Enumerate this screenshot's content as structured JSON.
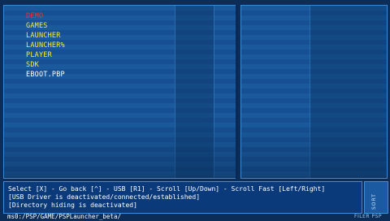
{
  "file_list": {
    "items": [
      {
        "name": "DEMO",
        "type": "folder",
        "selected": true
      },
      {
        "name": "GAMES",
        "type": "folder",
        "selected": false
      },
      {
        "name": "LAUNCHER",
        "type": "folder",
        "selected": false
      },
      {
        "name": "LAUNCHER%",
        "type": "folder",
        "selected": false
      },
      {
        "name": "PLAYER",
        "type": "folder",
        "selected": false
      },
      {
        "name": "SDK",
        "type": "folder",
        "selected": false
      },
      {
        "name": "EBOOT.PBP",
        "type": "file",
        "selected": false
      }
    ]
  },
  "status": {
    "controls_line": "Select [X] - Go back [^] - USB [R1] - Scroll [Up/Down] - Scroll Fast [Left/Right]",
    "usb_line": "[USB Driver is deactivated/connected/established]",
    "hiding_line": "[Directory hiding is deactivated]"
  },
  "sort_label": "SORT",
  "path": "ms0:/PSP/GAME/PSPLauncher_beta/",
  "brand": "FILER PSP",
  "colors": {
    "background": "#0c2d58",
    "stripe_a": "#1a5a9c",
    "stripe_b": "#165092",
    "folder_text": "#f2ef3a",
    "selected_text": "#ff2a2a",
    "file_text": "#ffffff"
  }
}
